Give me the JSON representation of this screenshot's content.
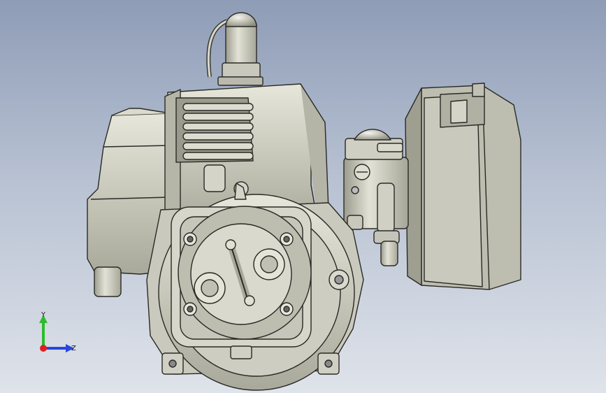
{
  "viewport": {
    "background_top": "#8e9cb6",
    "background_bottom": "#dfe3ea",
    "model_shade": "#cfcfc3"
  },
  "triad": {
    "y_label": "Y",
    "z_label": "Z",
    "y_color": "#2dbb2d",
    "z_color": "#2747e0",
    "x_color": "#e02020"
  }
}
